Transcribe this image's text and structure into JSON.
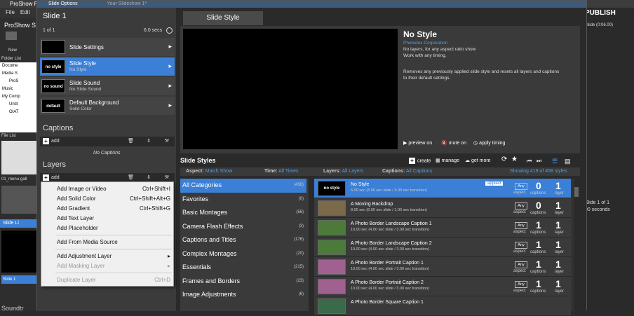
{
  "app": {
    "title": "ProShow P",
    "menu": [
      "File",
      "Edit"
    ],
    "project_label": "ProShow S",
    "new_label": "New",
    "folder_list": "Folder List",
    "tree": [
      "Docume",
      "Media S",
      "ProS",
      "My Comp",
      "Untit",
      "OIAT",
      "Music"
    ],
    "file_list": "File List",
    "file_caption": "01_menu-gall",
    "slide_list": "Slide Li",
    "slide1": "Slide 1",
    "soundtrack": "Soundtr",
    "publish": "PUBLISH",
    "right_info": "slide (0:06.00)",
    "slide_of": "Slide 1 of 1",
    "seconds": "00 seconds"
  },
  "dialog": {
    "title": "Slide Options",
    "subtitle": "Your Slideshow 1*"
  },
  "left": {
    "slide_title": "Slide 1",
    "slide_count": "1 of 1",
    "duration": "6.0 secs",
    "rows": [
      {
        "label": "Slide Settings",
        "sub": "",
        "thumb": ""
      },
      {
        "label": "Slide Style",
        "sub": "No Style",
        "thumb": "no style"
      },
      {
        "label": "Slide Sound",
        "sub": "No Slide Sound",
        "thumb": "no sound"
      },
      {
        "label": "Default Background",
        "sub": "Solid Color",
        "thumb": "default"
      }
    ],
    "captions_hdr": "Captions",
    "add": "add",
    "no_captions": "No Captions",
    "layers_hdr": "Layers"
  },
  "menu": {
    "items": [
      {
        "label": "Add Image or Video",
        "shortcut": "Ctrl+Shift+I"
      },
      {
        "label": "Add Solid Color",
        "shortcut": "Ctrl+Shift+Alt+G"
      },
      {
        "label": "Add Gradient",
        "shortcut": "Ctrl+Shift+G"
      },
      {
        "label": "Add Text Layer",
        "shortcut": ""
      },
      {
        "label": "Add Placeholder",
        "shortcut": ""
      },
      {
        "label": "Add From Media Source",
        "shortcut": ""
      },
      {
        "label": "Add Adjustment Layer",
        "shortcut": ""
      },
      {
        "label": "Add Masking Layer",
        "shortcut": ""
      },
      {
        "label": "Duplicate Layer",
        "shortcut": "Ctrl+D"
      }
    ]
  },
  "main": {
    "tab": "Slide Style",
    "style_name": "No Style",
    "vendor": "Photodex Corporation",
    "desc1": "No layers, for any aspect ratio show",
    "desc2": "Work with any timing.",
    "desc3": "Removes any previously applied slide style and resets all layers and captions",
    "desc4": "to their default settings.",
    "preview_on": "preview on",
    "mute_on": "mute on",
    "apply_timing": "apply timing",
    "ss_title": "Slide Styles",
    "create": "create",
    "manage": "manage",
    "get_more": "get more",
    "filter": {
      "aspect_l": "Aspect:",
      "aspect_v": "Match Show",
      "time_l": "Time:",
      "time_v": "All Times",
      "layers_l": "Layers:",
      "layers_v": "All Layers",
      "captions_l": "Captions:",
      "captions_v": "All Captions",
      "showing": "Showing 419 of 458 styles"
    },
    "categories": [
      {
        "name": "All Categories",
        "count": "(458)"
      },
      {
        "name": "Favorites",
        "count": "(0)"
      },
      {
        "name": "Basic Montages",
        "count": "(56)"
      },
      {
        "name": "Camera Flash Effects",
        "count": "(3)"
      },
      {
        "name": "Captions and Titles",
        "count": "(176)"
      },
      {
        "name": "Complex Montages",
        "count": "(20)"
      },
      {
        "name": "Essentials",
        "count": "(215)"
      },
      {
        "name": "Frames and Borders",
        "count": "(23)"
      },
      {
        "name": "Image Adjustments",
        "count": "(6)"
      }
    ],
    "styles": [
      {
        "name": "No Style",
        "desc": "6.00 sec (3.00 sec slide / 3.00 sec transition)",
        "thumb": "no style",
        "caps": "0",
        "layers": "1",
        "applied": "applied"
      },
      {
        "name": "A Moving Backdrop",
        "desc": "8.00 sec (6.00 sec slide / 1.00 sec transition)",
        "thumb": "",
        "caps": "0",
        "layers": "1",
        "applied": ""
      },
      {
        "name": "A Photo Border Landscape Caption 1",
        "desc": "10.00 sec (4.00 sec slide / 3.00 sec transition)",
        "thumb": "",
        "caps": "1",
        "layers": "1",
        "applied": ""
      },
      {
        "name": "A Photo Border Landscape Caption 2",
        "desc": "10.00 sec (4.00 sec slide / 3.00 sec transition)",
        "thumb": "",
        "caps": "1",
        "layers": "1",
        "applied": ""
      },
      {
        "name": "A Photo Border Portrait Caption 1",
        "desc": "10.00 sec (4.00 sec slide / 3.00 sec transition)",
        "thumb": "",
        "caps": "1",
        "layers": "1",
        "applied": ""
      },
      {
        "name": "A Photo Border Portrait Caption 2",
        "desc": "10.00 sec (4.00 sec slide / 3.00 sec transition)",
        "thumb": "",
        "caps": "1",
        "layers": "1",
        "applied": ""
      },
      {
        "name": "A Photo Border Square Caption 1",
        "desc": "",
        "thumb": "",
        "caps": "",
        "layers": "",
        "applied": ""
      }
    ],
    "any": "Any",
    "aspect": "aspect",
    "captions": "captions",
    "layer": "layer"
  }
}
